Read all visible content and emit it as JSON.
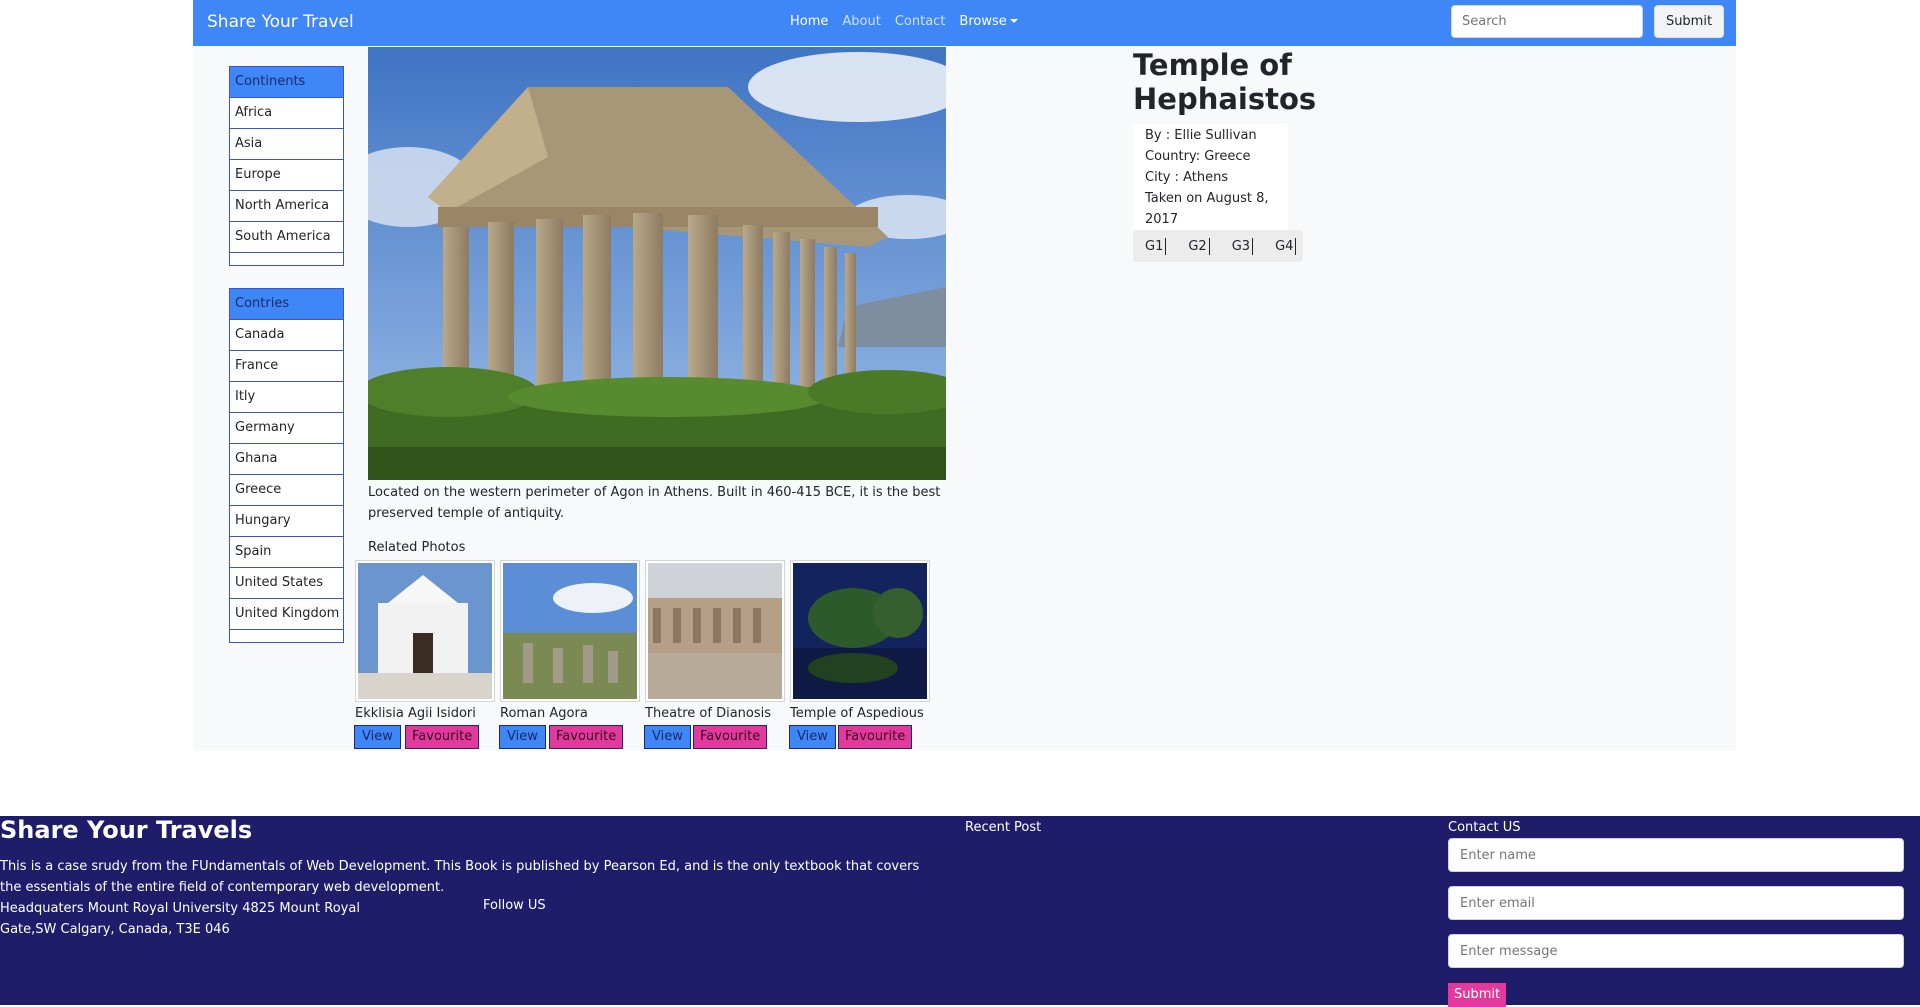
{
  "navbar": {
    "brand": "Share Your Travel",
    "links": [
      "Home",
      "About",
      "Contact",
      "Browse"
    ],
    "search_placeholder": "Search",
    "search_button": "Submit"
  },
  "continents": {
    "heading": "Continents",
    "items": [
      "Africa",
      "Asia",
      "Europe",
      "North America",
      "South America"
    ]
  },
  "countries": {
    "heading": "Contries",
    "items": [
      "Canada",
      "France",
      "Itly",
      "Germany",
      "Ghana",
      "Greece",
      "Hungary",
      "Spain",
      "United States",
      "United Kingdom"
    ]
  },
  "photo": {
    "title": "Temple of Hephaistos",
    "description": "Located on the western perimeter of Agon in Athens. Built in 460-415 BCE, it is the best preserved temple of antiquity.",
    "by": "By : Ellie Sullivan",
    "country": "Country: Greece",
    "city": "City : Athens",
    "taken": "Taken on August 8, 2017",
    "gbuttons": [
      "G1",
      "G2",
      "G3",
      "G4"
    ]
  },
  "related": {
    "heading": "Related Photos",
    "items": [
      {
        "title": "Ekklisia Agii Isidori",
        "view": "View",
        "fav": "Favourite"
      },
      {
        "title": "Roman Agora",
        "view": "View",
        "fav": "Favourite"
      },
      {
        "title": "Theatre of Dianosis",
        "view": "View",
        "fav": "Favourite"
      },
      {
        "title": "Temple of Aspedious",
        "view": "View",
        "fav": "Favourite"
      }
    ]
  },
  "footer": {
    "title": "Share Your Travels",
    "text": "This is a case srudy from the FUndamentals of Web Development. This Book is published by Pearson Ed, and is the only textbook that covers the essentials of the entire field of contemporary web development.",
    "address": "Headquaters Mount Royal University 4825 Mount Royal Gate,SW Calgary, Canada, T3E 046",
    "follow": "Follow US",
    "recent": "Recent Post",
    "contact_heading": "Contact US",
    "name_placeholder": "Enter name",
    "email_placeholder": "Enter email",
    "message_placeholder": "Enter message",
    "submit": "Submit"
  }
}
